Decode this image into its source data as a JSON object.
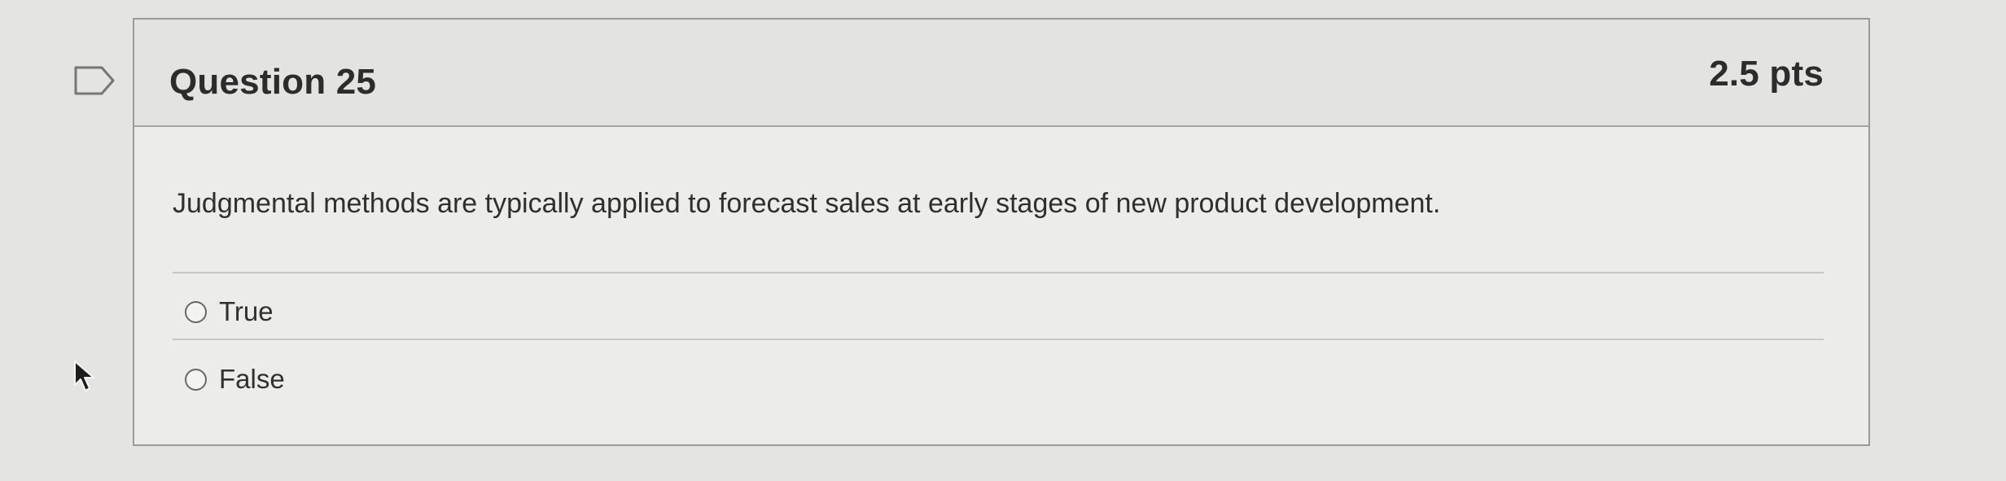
{
  "question": {
    "title": "Question 25",
    "points": "2.5 pts",
    "text": "Judgmental methods are typically applied to forecast sales at early stages of new product development."
  },
  "answers": [
    {
      "label": "True",
      "selected": false
    },
    {
      "label": "False",
      "selected": false
    }
  ],
  "icons": {
    "flag": "flag-icon",
    "cursor": "mouse-pointer-icon",
    "radio": "radio-button-icon"
  }
}
